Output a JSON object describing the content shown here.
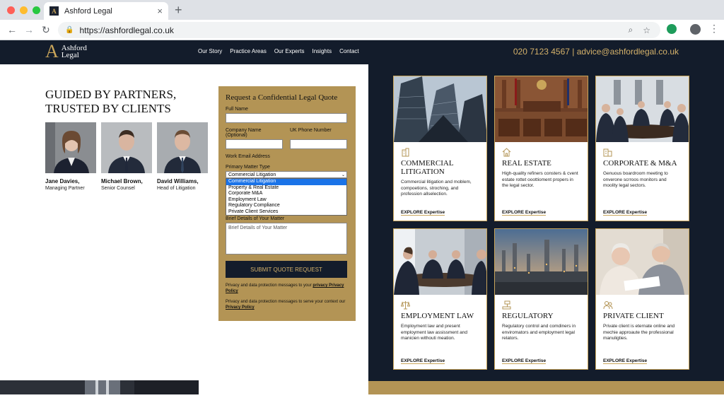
{
  "browser": {
    "tab_title": "Ashford Legal",
    "tab_close": "×",
    "new_tab": "+",
    "url": "https://ashfordlegal.co.uk",
    "tab_logo": "A"
  },
  "header": {
    "logo_mark": "A",
    "logo_line1": "Ashford",
    "logo_line2": "Legal",
    "nav": [
      "Our Story",
      "Practice Areas",
      "Our Experts",
      "Insights",
      "Contact"
    ],
    "contact": "020 7123 4567 | advice@ashfordlegal.co.uk"
  },
  "hero": {
    "line1": "Guided by Partners,",
    "line2": "Trusted by Clients"
  },
  "team": [
    {
      "name": "Jane Davies,",
      "role": "Managing Partner"
    },
    {
      "name": "Michael Brown,",
      "role": "Senior Counsel"
    },
    {
      "name": "David Williams,",
      "role": "Head of Litigation"
    }
  ],
  "form": {
    "title": "Request a Confidential Legal Quote",
    "full_name_label": "Full Name",
    "company_label": "Company Name (Optional)",
    "phone_label": "UK Phone Number",
    "email_label": "Work Email Address",
    "matter_label": "Primary Matter Type",
    "selected_matter": "Commercial Litigation",
    "options": [
      "Commercial Litigation",
      "Property & Real Estate",
      "Corporate M&A",
      "Employment Law",
      "Regulatory Compliance",
      "Private Client Services"
    ],
    "details_label": "Brief Details of Your Matter",
    "details_placeholder": "Brief Details of Your Matter",
    "submit": "Submit Quote Request",
    "privacy1_text": "Privacy and data protection messages to your ",
    "privacy1_link": "privacy Privacy Policy",
    "privacy2_text": "Privacy and data protection messages to serve your context our ",
    "privacy2_link": "Privacy Policy"
  },
  "cards": [
    {
      "title": "Commercial Litigation",
      "desc": "Commercial litigation and moblem, compoetions, stroching, and profession allselection.",
      "link": "EXPLORE Expertise",
      "icon": "building-icon"
    },
    {
      "title": "Real Estate",
      "desc": "High-quality refiners consters & cvent estate rottet ooottioment propers in the legal sector.",
      "link": "EXPLORE Expertise",
      "icon": "house-icon"
    },
    {
      "title": "Corporate & M&A",
      "desc": "Genuous boardroom meeting to onverone scrroos monitors and moolity legal sectors.",
      "link": "EXPLORE Expertise",
      "icon": "office-icon"
    },
    {
      "title": "Employment Law",
      "desc": "Employment law and present employment law assissment and manicien withouti meation.",
      "link": "EXPLORE Expertise",
      "icon": "scales-icon"
    },
    {
      "title": "Regulatory",
      "desc": "Regulatory control and comdiners in enviromators and employment legal relators.",
      "link": "EXPLORE Expertise",
      "icon": "gavel-icon"
    },
    {
      "title": "Private Client",
      "desc": "Private client is eternate online and mechie approaute the professional manuligties.",
      "link": "EXPLORE Expertise",
      "icon": "people-icon"
    }
  ],
  "colors": {
    "navy": "#131c2b",
    "gold": "#b39455",
    "gold_text": "#d4b16a"
  }
}
